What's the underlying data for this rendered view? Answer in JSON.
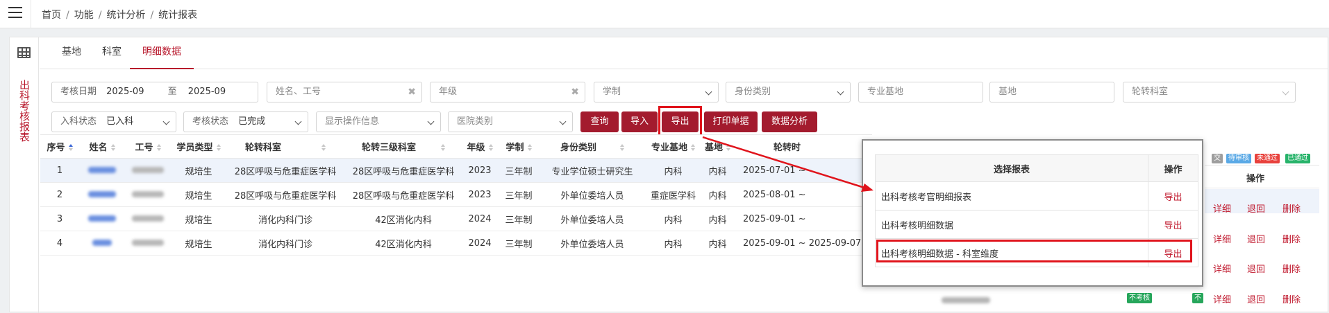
{
  "breadcrumb": {
    "items": [
      "首页",
      "功能",
      "统计分析",
      "统计报表"
    ]
  },
  "sidebar": {
    "vertical_title": "出科考核报表"
  },
  "tabs": [
    "基地",
    "科室",
    "明细数据"
  ],
  "filters": {
    "exam_date_label": "考核日期",
    "date_from": "2025-09",
    "date_to_sep": "至",
    "date_to": "2025-09",
    "name_placeholder": "姓名、工号",
    "grade_placeholder": "年级",
    "system_placeholder": "学制",
    "identity_placeholder": "身份类别",
    "specialty_base_placeholder": "专业基地",
    "base_placeholder": "基地",
    "rotation_dept_placeholder": "轮转科室",
    "entry_status_label": "入科状态",
    "entry_status_value": "已入科",
    "exam_status_label": "考核状态",
    "exam_status_value": "已完成",
    "show_ops_placeholder": "显示操作信息",
    "hospital_type_placeholder": "医院类别"
  },
  "buttons": {
    "query": "查询",
    "import": "导入",
    "export": "导出",
    "print": "打印单据",
    "analysis": "数据分析"
  },
  "status_tags": [
    {
      "text": "交",
      "color": "#9e9e9e"
    },
    {
      "text": "待审核",
      "color": "#5aa9e6"
    },
    {
      "text": "未通过",
      "color": "#e8413c"
    },
    {
      "text": "已通过",
      "color": "#27b36a"
    }
  ],
  "table": {
    "headers": [
      "序号",
      "姓名",
      "工号",
      "学员类型",
      "轮转科室",
      "轮转三级科室",
      "年级",
      "学制",
      "身份类别",
      "专业基地",
      "基地",
      "轮转时"
    ],
    "op_header": "操作",
    "rows": [
      {
        "no": "1",
        "type": "规培生",
        "dept": "28区呼吸与危重症医学科",
        "dept3": "28区呼吸与危重症医学科",
        "grade": "2023",
        "system": "三年制",
        "identity": "专业学位硕士研究生",
        "spec_base": "内科",
        "base": "内科",
        "period": "2025-07-01 ~"
      },
      {
        "no": "2",
        "type": "规培生",
        "dept": "28区呼吸与危重症医学科",
        "dept3": "28区呼吸与危重症医学科",
        "grade": "2023",
        "system": "三年制",
        "identity": "外单位委培人员",
        "spec_base": "重症医学科",
        "base": "内科",
        "period": "2025-08-01 ~"
      },
      {
        "no": "3",
        "type": "规培生",
        "dept": "消化内科门诊",
        "dept3": "42区消化内科",
        "grade": "2024",
        "system": "三年制",
        "identity": "外单位委培人员",
        "spec_base": "内科",
        "base": "内科",
        "period": "2025-09-01 ~"
      },
      {
        "no": "4",
        "type": "规培生",
        "dept": "消化内科门诊",
        "dept3": "42区消化内科",
        "grade": "2024",
        "system": "三年制",
        "identity": "外单位委培人员",
        "spec_base": "内科",
        "base": "内科",
        "period": "2025-09-01 ~ 2025-09-07"
      }
    ],
    "ops": {
      "detail": "详细",
      "back": "退回",
      "delete": "删除"
    },
    "row4_badge": "不考核",
    "row4_badge2": "不"
  },
  "popup": {
    "header_report": "选择报表",
    "header_action": "操作",
    "rows": [
      {
        "name": "出科考核考官明细报表",
        "action": "导出"
      },
      {
        "name": "出科考核明细数据",
        "action": "导出"
      },
      {
        "name": "出科考核明细数据 - 科室维度",
        "action": "导出"
      }
    ]
  },
  "colors": {
    "brand": "#a31b2e",
    "highlight": "#e0141c",
    "link": "#c0182d"
  }
}
